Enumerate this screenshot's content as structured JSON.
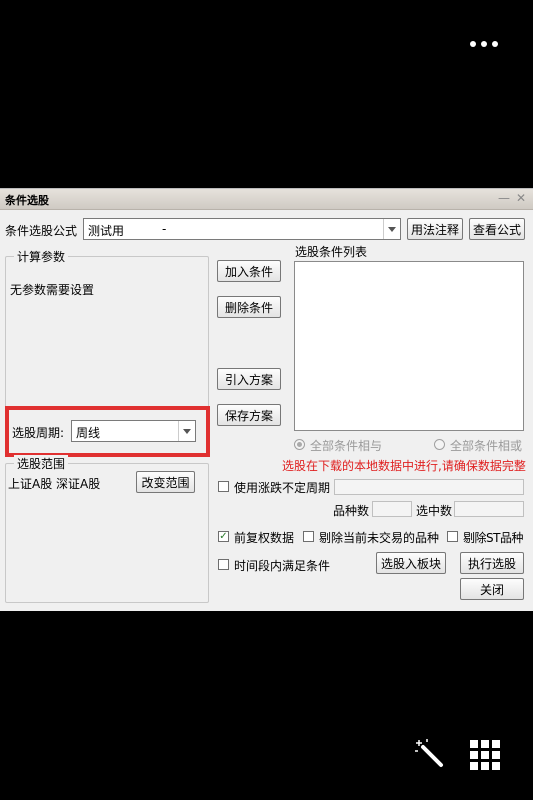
{
  "dialog": {
    "title": "条件选股",
    "minimize_glyph": "—",
    "close_glyph": "✕"
  },
  "formula": {
    "label": "条件选股公式",
    "value": "测试用",
    "value_suffix": "-",
    "usage_button": "用法注释",
    "view_button": "查看公式"
  },
  "params": {
    "group_label": "计算参数",
    "note": "无参数需要设置",
    "period_label": "选股周期:",
    "period_value": "周线"
  },
  "range": {
    "group_label": "选股范围",
    "value": "上证A股 深证A股",
    "change_button": "改变范围"
  },
  "actions": {
    "add": "加入条件",
    "delete": "删除条件",
    "import": "引入方案",
    "save": "保存方案"
  },
  "conditions": {
    "list_label": "选股条件列表",
    "radio_and": "全部条件相与",
    "radio_or": "全部条件相或",
    "warning": "选股在下载的本地数据中进行,请确保数据完整",
    "warning_color": "#e02020"
  },
  "options": {
    "uncertain_cycle": "使用涨跌不定周期",
    "stock_count_label": "品种数",
    "selected_count_label": "选中数",
    "pre_adjusted": "前复权数据",
    "exclude_untraded": "剔除当前未交易的品种",
    "exclude_st": "剔除ST品种",
    "time_range": "时间段内满足条件"
  },
  "buttons": {
    "to_block": "选股入板块",
    "execute": "执行选股",
    "close": "关闭"
  }
}
